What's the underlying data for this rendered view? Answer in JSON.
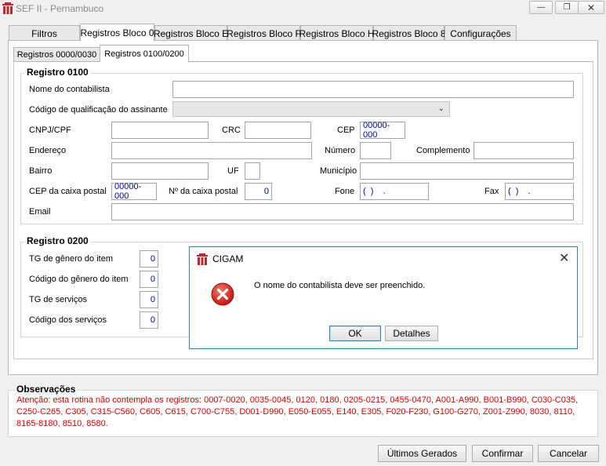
{
  "window": {
    "title": "SEF II - Pernambuco"
  },
  "tabs": [
    "Filtros",
    "Registros Bloco 0",
    "Registros Bloco E",
    "Registros Bloco F",
    "Registros Bloco H",
    "Registros Bloco 8",
    "Configurações"
  ],
  "subtabs": [
    "Registros 0000/0030",
    "Registros 0100/0200"
  ],
  "registro0100": {
    "title": "Registro 0100",
    "nome_label": "Nome do contabilista",
    "codigo_label": "Código de qualificação do assinante",
    "cnpj_label": "CNPJ/CPF",
    "crc_label": "CRC",
    "cep_label": "CEP",
    "cep_value": "00000-000",
    "endereco_label": "Endereço",
    "numero_label": "Número",
    "complemento_label": "Complemento",
    "bairro_label": "Bairro",
    "uf_label": "UF",
    "municipio_label": "Município",
    "cep_caixa_label": "CEP da caixa postal",
    "cep_caixa_value": "00000-000",
    "num_caixa_label": "Nº da caixa postal",
    "num_caixa_value": "0",
    "fone_label": "Fone",
    "fone_value": "(  )    .",
    "fax_label": "Fax",
    "fax_value": "(  )    .",
    "email_label": "Email"
  },
  "registro0200": {
    "title": "Registro 0200",
    "rows": [
      {
        "label": "TG de gênero do item",
        "value": "0"
      },
      {
        "label": "Código do gênero do item",
        "value": "0"
      },
      {
        "label": "TG de serviços",
        "value": "0"
      },
      {
        "label": "Código dos serviços",
        "value": "0"
      }
    ]
  },
  "observacoes": {
    "title": "Observações",
    "text": "Atenção: esta rotina não contempla os registros: 0007-0020, 0035-0045, 0120, 0180, 0205-0215, 0455-0470, A001-A990, B001-B990, C030-C035, C250-C265, C305, C315-C560, C605, C615, C700-C755, D001-D990, E050-E055, E140, E305, F020-F230, G100-G270, Z001-Z990, 8030, 8110, 8165-8180, 8510, 8580."
  },
  "buttons": {
    "ultimos": "Últimos Gerados",
    "confirmar": "Confirmar",
    "cancelar": "Cancelar"
  },
  "dialog": {
    "title": "CIGAM",
    "message": "O nome do contabilista deve ser preenchido.",
    "ok": "OK",
    "detalhes": "Detalhes"
  },
  "colors": {
    "error_red": "#e00000",
    "accent_blue": "#3c7fb1",
    "value_blue": "#0000a0"
  },
  "icons": [
    "cigam-logo-icon",
    "minimize-icon",
    "restore-icon",
    "close-icon",
    "error-icon",
    "chevron-down-icon"
  ]
}
